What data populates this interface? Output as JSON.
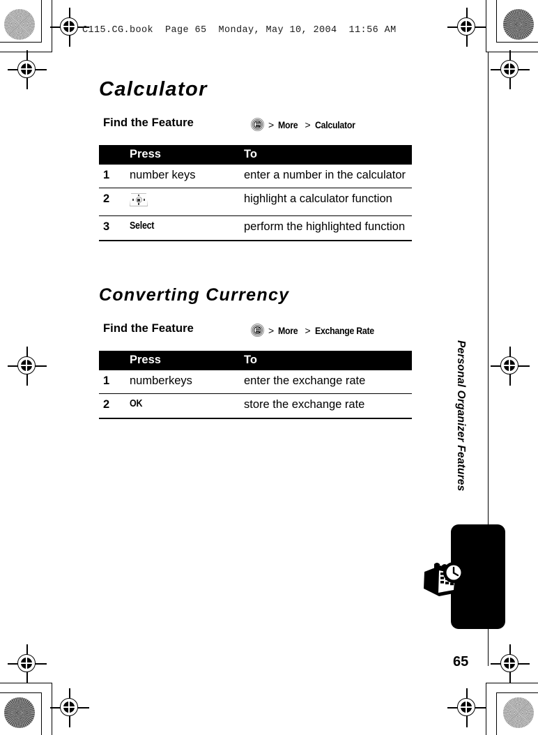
{
  "document": {
    "header_note": "C115.CG.book  Page 65  Monday, May 10, 2004  11:56 AM",
    "page_number": "65",
    "side_tab_title": "Personal Organizer Features"
  },
  "sections": [
    {
      "title": "Calculator",
      "title_style": "chapter",
      "find_the_feature": {
        "label": "Find the Feature",
        "menu_icon": "menu-key-icon",
        "separator": ">",
        "path": [
          "More",
          "Calculator"
        ]
      },
      "table": {
        "headers": [
          "",
          "Press",
          "To"
        ],
        "rows": [
          {
            "num": "1",
            "press": "number keys",
            "press_type": "text",
            "to": "enter a number in the calculator"
          },
          {
            "num": "2",
            "press": "",
            "press_type": "nav-key-icon",
            "to": "highlight a calculator function"
          },
          {
            "num": "3",
            "press": "Select",
            "press_type": "softkey",
            "to": "perform the highlighted function"
          }
        ]
      }
    },
    {
      "title": "Converting Currency",
      "title_style": "section",
      "find_the_feature": {
        "label": "Find the Feature",
        "menu_icon": "menu-key-icon",
        "separator": ">",
        "path": [
          "More",
          "Exchange Rate"
        ]
      },
      "table": {
        "headers": [
          "",
          "Press",
          "To"
        ],
        "rows": [
          {
            "num": "1",
            "press": "numberkeys",
            "press_type": "text",
            "to": "enter the exchange rate"
          },
          {
            "num": "2",
            "press": "OK",
            "press_type": "softkey",
            "to": "store the exchange rate"
          }
        ]
      }
    }
  ],
  "colors": {
    "ink": "#000000",
    "paper": "#ffffff",
    "table_header_bg": "#000000",
    "table_header_fg": "#ffffff"
  }
}
